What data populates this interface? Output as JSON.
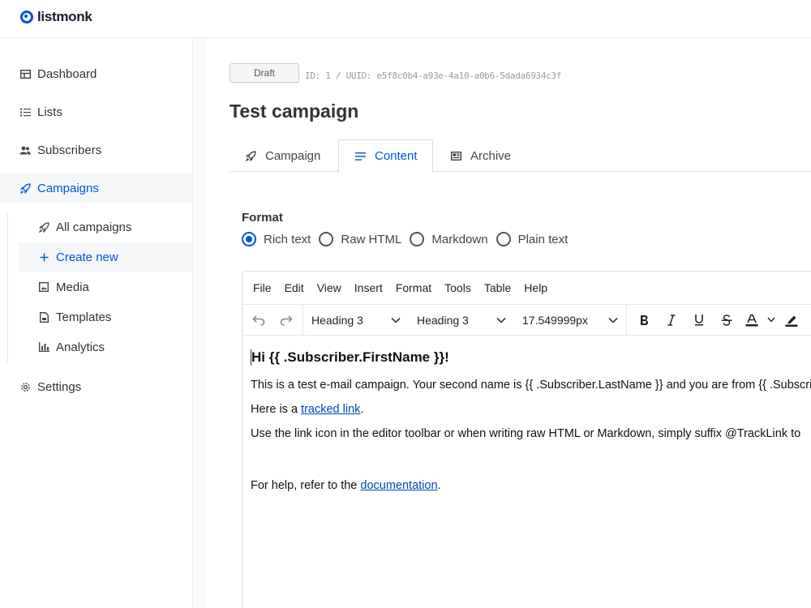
{
  "app": {
    "name": "listmonk",
    "accent": "#0055d4"
  },
  "sidebar": {
    "items": [
      {
        "label": "Dashboard",
        "icon": "dashboard-icon"
      },
      {
        "label": "Lists",
        "icon": "list-icon"
      },
      {
        "label": "Subscribers",
        "icon": "users-icon"
      },
      {
        "label": "Campaigns",
        "icon": "rocket-icon",
        "active": true
      },
      {
        "label": "Settings",
        "icon": "gear-icon"
      }
    ],
    "campaign_sub": [
      {
        "label": "All campaigns",
        "icon": "rocket-icon"
      },
      {
        "label": "Create new",
        "icon": "plus-icon",
        "active": true
      },
      {
        "label": "Media",
        "icon": "image-icon"
      },
      {
        "label": "Templates",
        "icon": "file-icon"
      },
      {
        "label": "Analytics",
        "icon": "bar-chart-icon"
      }
    ]
  },
  "campaign": {
    "status": "Draft",
    "id_line": "ID: 1 / UUID: e5f8c0b4-a93e-4a10-a0b6-5dada6934c3f",
    "title": "Test campaign"
  },
  "tabs": [
    {
      "label": "Campaign",
      "icon": "rocket-icon"
    },
    {
      "label": "Content",
      "icon": "align-left-icon",
      "active": true
    },
    {
      "label": "Archive",
      "icon": "newspaper-icon"
    }
  ],
  "format": {
    "label": "Format",
    "options": [
      {
        "label": "Rich text",
        "checked": true
      },
      {
        "label": "Raw HTML",
        "checked": false
      },
      {
        "label": "Markdown",
        "checked": false
      },
      {
        "label": "Plain text",
        "checked": false
      }
    ]
  },
  "editor": {
    "menu": [
      "File",
      "Edit",
      "View",
      "Insert",
      "Format",
      "Tools",
      "Table",
      "Help"
    ],
    "block_format": "Heading 3",
    "font_family": "Heading 3",
    "font_size": "17.549999px",
    "body": {
      "heading": "Hi {{ .Subscriber.FirstName }}!",
      "p1": "This is a test e-mail campaign. Your second name is {{ .Subscriber.LastName }} and you are from {{ .Subscriber.Attribs.city }}.",
      "p2_prefix": "Here is a ",
      "p2_link": "tracked link",
      "p2_suffix": ".",
      "p3": "Use the link icon in the editor toolbar or when writing raw HTML or Markdown, simply suffix @TrackLink to",
      "p4_prefix": "For help, refer to the ",
      "p4_link": "documentation",
      "p4_suffix": "."
    }
  }
}
